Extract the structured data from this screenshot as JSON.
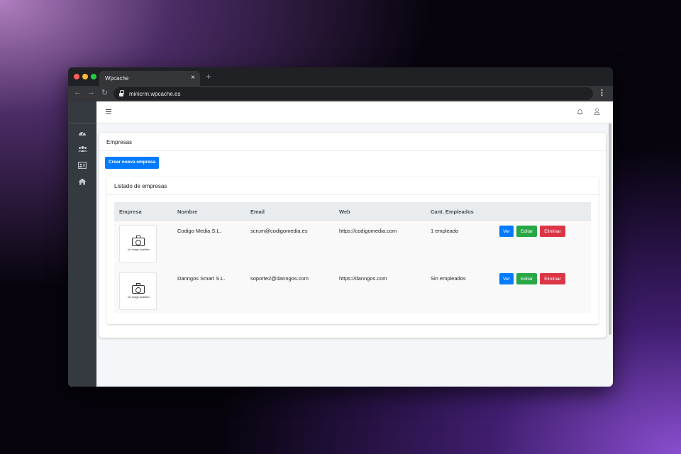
{
  "browser": {
    "tab_title": "Wpcache",
    "tab_close": "×",
    "new_tab": "+",
    "url": "minicrm.wpcache.es"
  },
  "topbar": {},
  "page": {
    "title": "Empresas",
    "create_button": "Crear nueva empresa",
    "list_title": "Listado de empresas"
  },
  "table": {
    "headers": [
      "Empresa",
      "Nombre",
      "Email",
      "Web",
      "Cant. Empleados"
    ],
    "rows": [
      {
        "logo_text": "No Image Available",
        "nombre": "Codigo Media S.L.",
        "email": "scrum@codigomedia.es",
        "web": "https://codigomedia.com",
        "empleados": "1 empleado"
      },
      {
        "logo_text": "No Image Available",
        "nombre": "Danngos Smart S.L.",
        "email": "soporte2@danngos.com",
        "web": "https://danngos.com",
        "empleados": "Sin empleados"
      }
    ],
    "actions": {
      "ver": "Ver",
      "editar": "Editar",
      "eliminar": "Eliminar"
    }
  },
  "colors": {
    "primary": "#007bff",
    "success": "#28a745",
    "danger": "#dc3545",
    "sidebar": "#343a40"
  },
  "icons": [
    "tachometer-icon",
    "users-icon",
    "id-card-icon",
    "home-icon",
    "bell-icon",
    "user-icon",
    "hamburger-icon",
    "camera-icon"
  ]
}
